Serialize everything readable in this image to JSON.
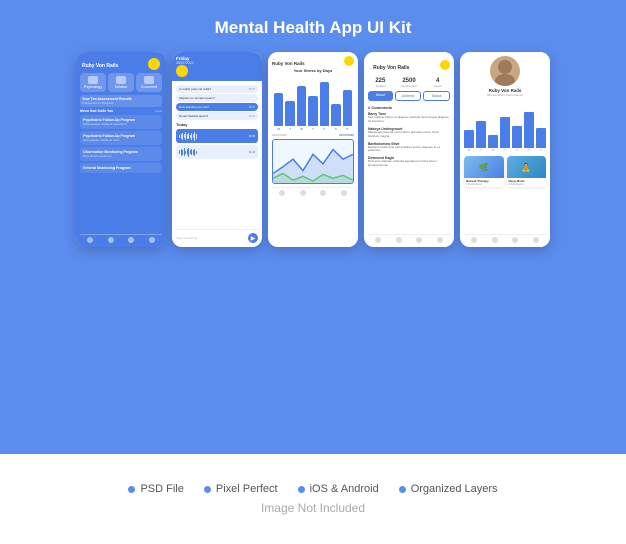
{
  "page": {
    "title": "Mental Health App UI Kit",
    "background_color": "#5b8dee"
  },
  "features": [
    {
      "label": "PSD File",
      "dot_color": "#5b8dee"
    },
    {
      "label": "Pixel Perfect",
      "dot_color": "#5b8dee"
    },
    {
      "label": "iOS & Android",
      "dot_color": "#5b8dee"
    },
    {
      "label": "Organized Layers",
      "dot_color": "#5b8dee"
    }
  ],
  "footer": {
    "label": "Image Not Included"
  },
  "phone1": {
    "user": "Ruby Von Rails",
    "cards": [
      "Psychology",
      "Solution",
      "Document"
    ],
    "section": "Menu that Suits You",
    "items": [
      {
        "title": "Psychiatric Follow-Up Program",
        "sub": "Pellentesque tincidunt nonentum"
      },
      {
        "title": "Psychiatric Follow-Up Program",
        "sub": "Sed pretium media ac nunc rutrum"
      },
      {
        "title": "Observation Monitoring Program",
        "sub": "Duis auctor ornare ex"
      },
      {
        "title": "General Monitoring Program",
        "sub": ""
      }
    ]
  },
  "phone2": {
    "header_day": "Friday",
    "messages": [
      {
        "text": "In mattis justo vel nulla?",
        "time": "08:37",
        "type": "received"
      },
      {
        "text": "Aliquam eu tempus quam?",
        "time": "08:37",
        "type": "received"
      },
      {
        "text": "Duis interdum ac orci?",
        "time": "08:57",
        "type": "sent"
      },
      {
        "text": "Donec facilisis apam?",
        "time": "02:18",
        "type": "received"
      }
    ],
    "section_today": "Today",
    "placeholder": "Type something..."
  },
  "phone3": {
    "user": "Ruby Von Rails",
    "chart_title": "Your Stress by Days",
    "days": [
      "Mon",
      "Tue",
      "Wed",
      "Thu",
      "Fri",
      "Sat",
      "Sun"
    ],
    "bar_values": [
      60,
      45,
      75,
      55,
      80,
      40,
      65
    ]
  },
  "phone4": {
    "user": "Ruby Von Rails",
    "stats": [
      {
        "num": "225",
        "label": "Treated"
      },
      {
        "num": "2500",
        "label": "Discharged"
      },
      {
        "num": "4",
        "label": "Years"
      }
    ],
    "buttons": [
      "About",
      "Address",
      "Status"
    ],
    "comments_title": "# Comments",
    "comments": [
      {
        "name": "Barry Tone",
        "text": "Sed pulvinar libero on aliquam vehicula Sed congue aliquam libero, sit interdum."
      },
      {
        "name": "Nakeya Undergrount",
        "text": "Maecenas placerat nisl in libero gravida Lectus aliquus. Nunc tincidunt magna."
      },
      {
        "name": "Bartholomew Stive",
        "text": "Eleifend mattis ante just tincidunt simply sector. Aliquam in ex pellentes in."
      },
      {
        "name": "Desmond Eagle",
        "text": "Duis eros aliquam vehicula agenda massa turm Duis lorem. Donec @ndolysenmte"
      }
    ]
  },
  "phone5": {
    "user": "Ruby Von Rails",
    "sub": "585 Excellent Performance",
    "days": [
      "Mon",
      "Tue",
      "Wed",
      "Thu",
      "Fri",
      "Sat",
      "Sun"
    ],
    "bar_values": [
      40,
      60,
      30,
      70,
      50,
      80,
      45
    ],
    "cards": [
      {
        "label": "Natural Therapy",
        "sub": "# Participation"
      },
      {
        "label": "Deep Mode",
        "sub": "# Participation"
      }
    ]
  }
}
